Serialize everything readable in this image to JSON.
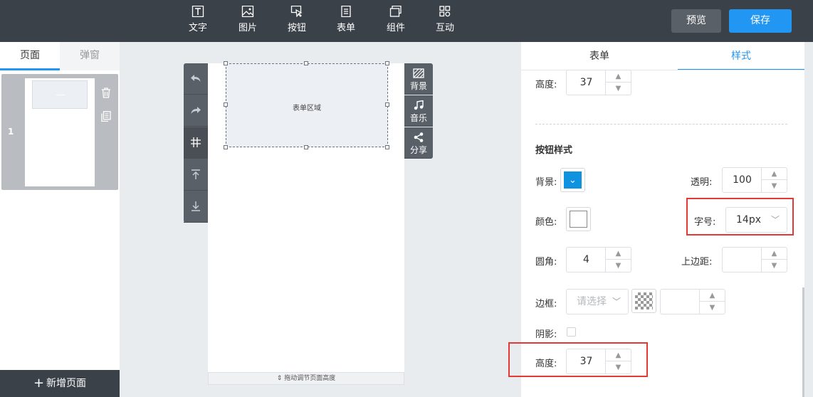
{
  "toolbar": {
    "tools": [
      {
        "label": "文字",
        "icon": "text-icon"
      },
      {
        "label": "图片",
        "icon": "image-icon"
      },
      {
        "label": "按钮",
        "icon": "button-icon"
      },
      {
        "label": "表单",
        "icon": "form-icon"
      },
      {
        "label": "组件",
        "icon": "component-icon"
      },
      {
        "label": "互动",
        "icon": "interaction-icon"
      }
    ],
    "preview_label": "预览",
    "save_label": "保存"
  },
  "left_panel": {
    "tabs": [
      "页面",
      "弹窗"
    ],
    "page_number": "1",
    "add_page_label": "新增页面"
  },
  "canvas": {
    "form_area_label": "表单区域",
    "resize_hint": "拖动调节页面高度",
    "right_tools": [
      "背景",
      "音乐",
      "分享"
    ]
  },
  "right_panel": {
    "tabs": [
      "表单",
      "样式"
    ],
    "top_height_label": "高度:",
    "top_height_value": "37",
    "section_title": "按钮样式",
    "background_label": "背景:",
    "opacity_label": "透明:",
    "opacity_value": "100",
    "color_label": "颜色:",
    "font_size_label": "字号:",
    "font_size_value": "14px",
    "radius_label": "圆角:",
    "radius_value": "4",
    "margin_top_label": "上边距:",
    "margin_top_value": "",
    "border_label": "边框:",
    "border_placeholder": "请选择",
    "border_width_value": "",
    "shadow_label": "阴影:",
    "height_label": "高度:",
    "height_value": "37"
  },
  "colors": {
    "accent": "#2196f3",
    "toolbar_bg": "#3b4149",
    "button_bg_swatch": "#0f93e0",
    "highlight_red": "#e53935"
  }
}
